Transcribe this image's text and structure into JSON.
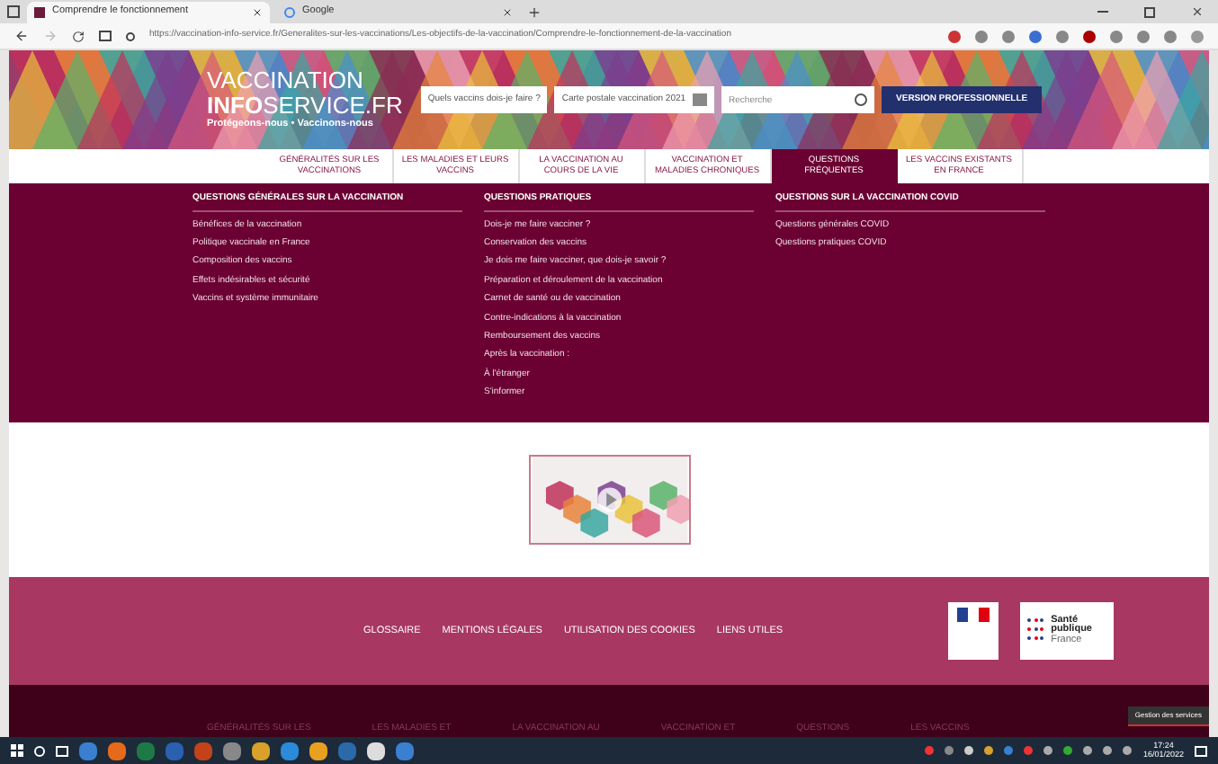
{
  "browser": {
    "tabs": [
      {
        "label": "Comprendre le fonctionnement",
        "selected": true
      },
      {
        "label": "Google",
        "selected": false
      }
    ],
    "url": "https://vaccination-info-service.fr/Generalites-sur-les-vaccinations/Les-objectifs-de-la-vaccination/Comprendre-le-fonctionnement-de-la-vaccination"
  },
  "header": {
    "logo_line1": "VACCINATION",
    "logo_info": "INFO",
    "logo_service": "SERVICE.FR",
    "tagline": "Protégeons-nous • Vaccinons-nous",
    "fields": [
      {
        "value": "Quels vaccins dois-je faire ?"
      },
      {
        "value": "Carte postale vaccination 2021"
      }
    ],
    "search": {
      "placeholder": "Recherche"
    },
    "pro_button": "VERSION PROFESSIONNELLE"
  },
  "nav": [
    {
      "label": "GÉNÉRALITÉS SUR LES VACCINATIONS",
      "selected": false
    },
    {
      "label": "LES MALADIES ET LEURS VACCINS",
      "selected": false
    },
    {
      "label": "LA VACCINATION AU COURS DE LA VIE",
      "selected": false
    },
    {
      "label": "VACCINATION ET MALADIES CHRONIQUES",
      "selected": false
    },
    {
      "label": "QUESTIONS FRÉQUENTES",
      "selected": true
    },
    {
      "label": "LES VACCINS EXISTANTS EN FRANCE",
      "selected": false
    }
  ],
  "dropdown": [
    {
      "heading": "QUESTIONS GÉNÉRALES SUR LA VACCINATION",
      "items": [
        "Bénéfices de la vaccination",
        "Politique vaccinale en France",
        "Composition des vaccins",
        "Effets indésirables et sécurité",
        "Vaccins et système immunitaire"
      ]
    },
    {
      "heading": "QUESTIONS PRATIQUES",
      "items": [
        "Dois-je me faire vacciner ?",
        "Conservation des vaccins",
        "Je dois me faire vacciner, que dois-je savoir ?",
        "Préparation et déroulement de la vaccination",
        "Carnet de santé ou de vaccination",
        "Contre-indications à la vaccination",
        "Remboursement des vaccins",
        "Après la vaccination :",
        "À l'étranger",
        "S'informer"
      ]
    },
    {
      "heading": "QUESTIONS SUR LA VACCINATION COVID",
      "items": [
        "Questions générales COVID",
        "Questions pratiques COVID"
      ]
    }
  ],
  "footer": {
    "links": [
      "GLOSSAIRE",
      "MENTIONS LÉGALES",
      "UTILISATION DES COOKIES",
      "LIENS UTILES"
    ],
    "sante_logo": [
      "Santé",
      "publique",
      "France"
    ]
  },
  "bottom_nav": [
    "GÉNÉRALITÉS SUR LES",
    "LES MALADIES ET",
    "LA VACCINATION AU",
    "VACCINATION ET",
    "QUESTIONS",
    "LES VACCINS"
  ],
  "cookie_button": "Gestion des services",
  "taskbar": {
    "time": "17:24",
    "date": "16/01/2022"
  }
}
